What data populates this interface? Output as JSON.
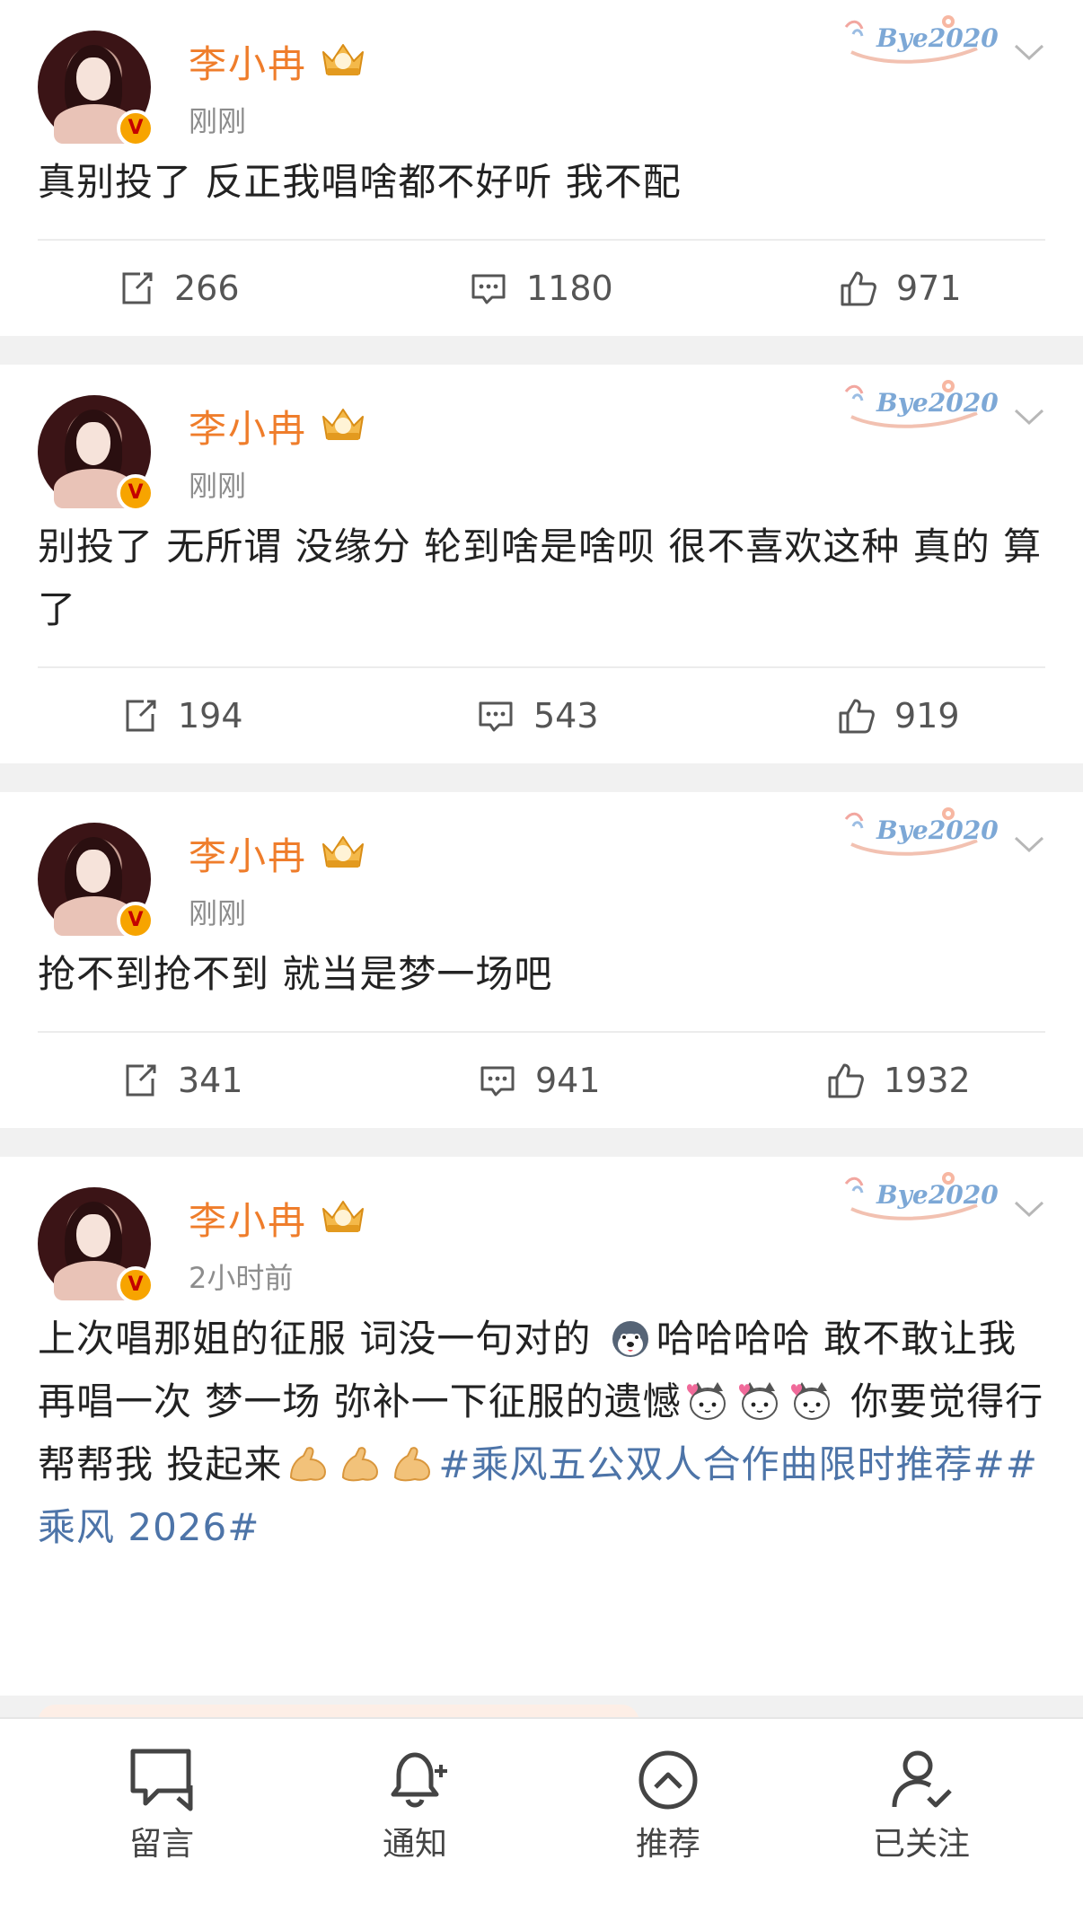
{
  "posts": [
    {
      "username": "李小冉",
      "vip_level": "10",
      "time": "刚刚",
      "text": "真别投了 反正我唱啥都不好听 我不配",
      "topics": "",
      "repost_count": "266",
      "comment_count": "1180",
      "like_count": "971"
    },
    {
      "username": "李小冉",
      "vip_level": "10",
      "time": "刚刚",
      "text": "别投了 无所谓 没缘分 轮到啥是啥呗 很不喜欢这种 真的 算了",
      "topics": "",
      "repost_count": "194",
      "comment_count": "543",
      "like_count": "919"
    },
    {
      "username": "李小冉",
      "vip_level": "10",
      "time": "刚刚",
      "text": "抢不到抢不到 就当是梦一场吧",
      "topics": "",
      "repost_count": "341",
      "comment_count": "941",
      "like_count": "1932"
    },
    {
      "username": "李小冉",
      "vip_level": "10",
      "time": "2小时前",
      "text_part1": "上次唱那姐的征服 词没一句对的",
      "text_part2": "哈哈哈哈 敢不敢让我再唱一次 梦一场 弥补一下征服的遗憾",
      "text_part3": "你要觉得行 帮帮我 投起来",
      "topics": "#乘风五公双人合作曲限时推荐##乘风 2026#"
    }
  ],
  "badge": {
    "frame_text": "Bye2020"
  },
  "bottom_nav": [
    {
      "label": "留言",
      "icon": "message-icon"
    },
    {
      "label": "通知",
      "icon": "bell-plus-icon"
    },
    {
      "label": "推荐",
      "icon": "chevron-up-circle-icon"
    },
    {
      "label": "已关注",
      "icon": "user-check-icon"
    }
  ],
  "colors": {
    "username": "#ef7d2b",
    "topic": "#4d74a8",
    "verified_badge": "#f7a400"
  }
}
